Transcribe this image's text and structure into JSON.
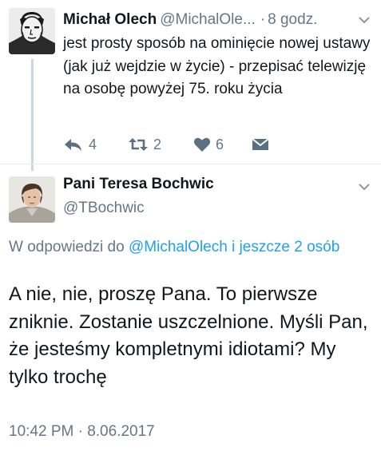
{
  "tweet": {
    "author_name": "Michał Olech",
    "author_handle": "@MichalOle...",
    "separator": "·",
    "time": "8 godz.",
    "text": "jest prosty sposób na ominięcie nowej ustawy (jak już wejdzie w życie) - przepisać telewizję na osobę powyżej 75. roku życia",
    "actions": {
      "reply_count": "4",
      "retweet_count": "2",
      "like_count": "6"
    },
    "icons": {
      "avatar": "avatar-portrait-icon",
      "menu": "chevron-down-icon",
      "reply": "reply-icon",
      "retweet": "retweet-icon",
      "like": "heart-icon",
      "message": "envelope-icon"
    }
  },
  "reply": {
    "author_name": "Pani Teresa Bochwic",
    "author_handle": "@TBochwic",
    "reply_prefix": "W odpowiedzi do",
    "reply_link": "@MichalOlech i jeszcze 2 osób",
    "text": "A nie, nie, proszę Pana. To pierwsze zniknie. Zostanie uszczelnione. Myśli Pan, że jesteśmy kompletnymi idiotami? My tylko trochę",
    "timestamp": "10:42 PM · 8.06.2017"
  },
  "colors": {
    "text": "#14171a",
    "secondary": "#657786",
    "link": "#1da1f2",
    "divider": "#e6ecf0",
    "thread_line": "#ccd6dd",
    "icon": "#5b7083"
  }
}
